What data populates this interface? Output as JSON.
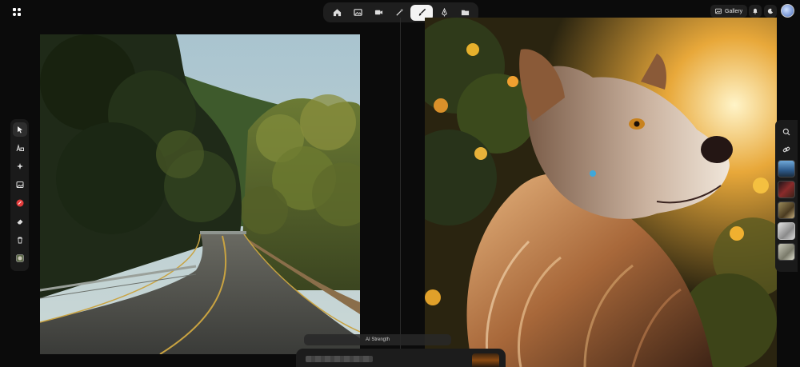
{
  "toolbar": {
    "items": [
      {
        "name": "home",
        "icon": "home-icon",
        "active": false
      },
      {
        "name": "image",
        "icon": "image-icon",
        "active": false
      },
      {
        "name": "video",
        "icon": "video-icon",
        "active": false
      },
      {
        "name": "enhance",
        "icon": "magic-wand-icon",
        "active": false
      },
      {
        "name": "edit",
        "icon": "brush-icon",
        "active": true
      },
      {
        "name": "draw",
        "icon": "pen-nib-icon",
        "active": false
      },
      {
        "name": "folder",
        "icon": "folder-icon",
        "active": false
      }
    ]
  },
  "header": {
    "gallery_label": "Gallery",
    "notification_icon": "bell-icon",
    "theme_icon": "moon-icon"
  },
  "left_tools": [
    "cursor-icon",
    "shapes-text-icon",
    "sparkles-icon",
    "image-icon",
    "color-swatch-icon",
    "eraser-icon",
    "trash-icon",
    "thumbnail-icon"
  ],
  "right_tools": [
    "search-icon",
    "link-icon"
  ],
  "bottom": {
    "ai_strength_label": "AI Strength"
  },
  "colors": {
    "background": "#0b0b0b",
    "panel": "#1e1e1e",
    "active_tool": "#f4f4f4",
    "accent_red": "#e23b3b"
  }
}
